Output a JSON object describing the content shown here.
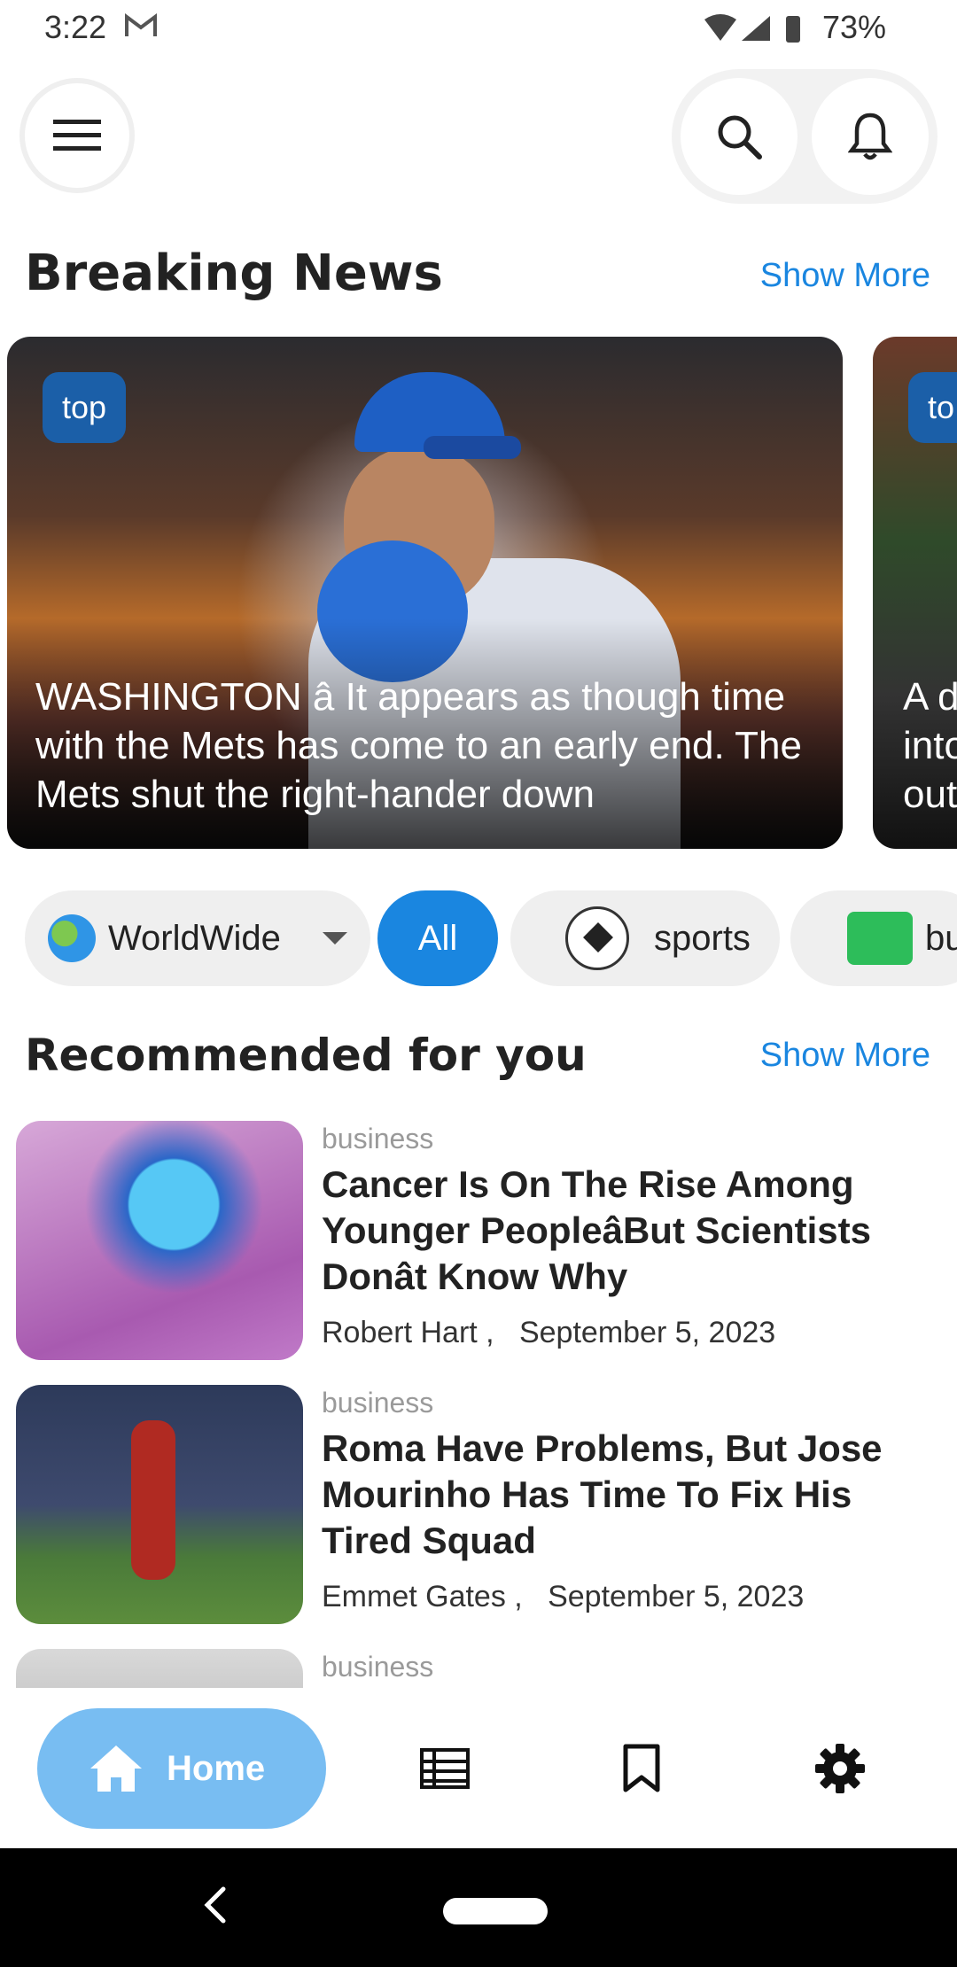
{
  "status_bar": {
    "time": "3:22",
    "battery": "73%"
  },
  "header": {
    "menu_icon": "menu-icon",
    "search_icon": "search-icon",
    "notification_icon": "bell-icon"
  },
  "breaking": {
    "title": "Breaking News",
    "show_more": "Show More",
    "cards": [
      {
        "tag": "top",
        "headline": "WASHINGTON â It appears as though time with the Mets has come to an early end. The Mets shut the right-hander down"
      },
      {
        "tag": "to",
        "headline": "A d\ninto\nout"
      }
    ]
  },
  "chips": {
    "region": "WorldWide",
    "all": "All",
    "sports": "sports",
    "business": "bu"
  },
  "recommended": {
    "title": "Recommended for you",
    "show_more": "Show More",
    "items": [
      {
        "category": "business",
        "title": "Cancer Is On The Rise Among Younger PeopleâBut Scientists Donât Know Why",
        "author": "Robert Hart",
        "date": "September 5, 2023"
      },
      {
        "category": "business",
        "title": "Roma Have Problems, But Jose Mourinho Has Time To Fix His Tired Squad",
        "author": "Emmet Gates",
        "date": "September 5, 2023"
      },
      {
        "category": "business"
      }
    ]
  },
  "bottom_nav": {
    "home": "Home"
  },
  "colors": {
    "accent": "#1a86e0",
    "home_pill": "#78bdf2",
    "tag_chip": "#1b5fa8"
  }
}
